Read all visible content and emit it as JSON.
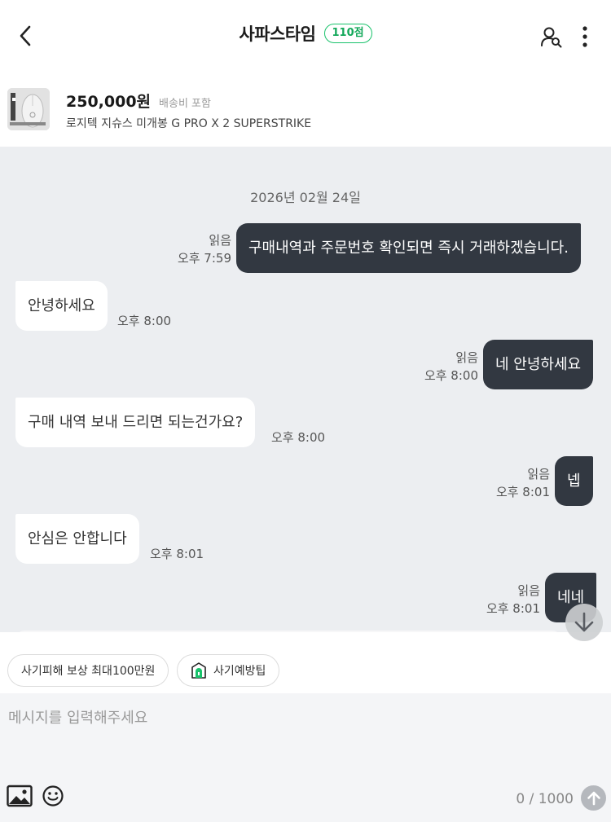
{
  "header": {
    "title": "사파스타임",
    "score_badge": "110점",
    "back_icon": "chevron-left-icon",
    "profile_icon": "user-search-icon",
    "more_icon": "more-vertical-icon"
  },
  "product": {
    "price": "250,000원",
    "shipping": "배송비 포함",
    "name": "로지텍 지슈스 미개봉 G PRO X 2 SUPERSTRIKE",
    "thumbnail": "mouse-product-image"
  },
  "chat": {
    "date": "2026년 02월 24일",
    "messages": [
      {
        "side": "mine",
        "text": "구매내역과 주문번호 확인되면 즉시 거래하겠습니다.",
        "read": "읽음",
        "time": "오후 7:59"
      },
      {
        "side": "other",
        "text": "안녕하세요",
        "time": "오후 8:00"
      },
      {
        "side": "mine",
        "text": "네 안녕하세요",
        "read": "읽음",
        "time": "오후 8:00"
      },
      {
        "side": "other",
        "text": "구매 내역 보내 드리면 되는건가요?",
        "time": "오후 8:00"
      },
      {
        "side": "mine",
        "text": "넵",
        "read": "읽음",
        "time": "오후 8:01"
      },
      {
        "side": "other",
        "text": "안심은 안합니다",
        "time": "오후 8:01"
      },
      {
        "side": "mine",
        "text": "네네",
        "read": "읽음",
        "time": "오후 8:01"
      }
    ]
  },
  "chips": [
    {
      "label": "사기피해 보상 최대100만원"
    },
    {
      "label": "사기예방팁",
      "icon": "shield-house-icon"
    }
  ],
  "composer": {
    "placeholder": "메시지를 입력해주세요",
    "counter": "0 / 1000",
    "image_icon": "image-icon",
    "emoji_icon": "emoji-icon",
    "send_icon": "arrow-up-icon"
  },
  "colors": {
    "accent": "#19c26b",
    "my_bubble": "#323841",
    "chat_bg": "#eceef1"
  }
}
